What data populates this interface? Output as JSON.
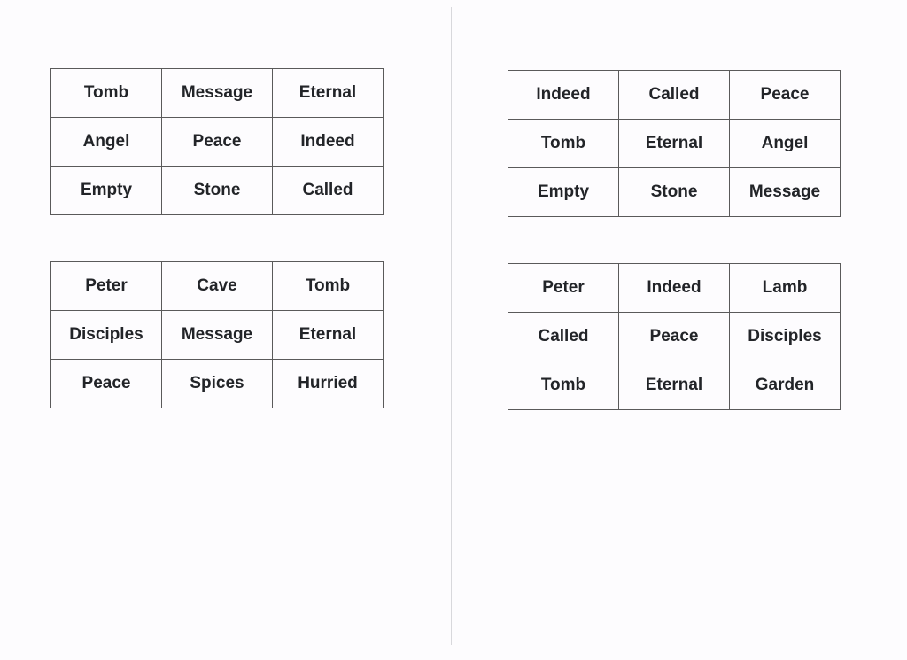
{
  "grids": [
    {
      "rows": [
        [
          "Tomb",
          "Message",
          "Eternal"
        ],
        [
          "Angel",
          "Peace",
          "Indeed"
        ],
        [
          "Empty",
          "Stone",
          "Called"
        ]
      ]
    },
    {
      "rows": [
        [
          "Peter",
          "Cave",
          "Tomb"
        ],
        [
          "Disciples",
          "Message",
          "Eternal"
        ],
        [
          "Peace",
          "Spices",
          "Hurried"
        ]
      ]
    },
    {
      "rows": [
        [
          "Indeed",
          "Called",
          "Peace"
        ],
        [
          "Tomb",
          "Eternal",
          "Angel"
        ],
        [
          "Empty",
          "Stone",
          "Message"
        ]
      ]
    },
    {
      "rows": [
        [
          "Peter",
          "Indeed",
          "Lamb"
        ],
        [
          "Called",
          "Peace",
          "Disciples"
        ],
        [
          "Tomb",
          "Eternal",
          "Garden"
        ]
      ]
    }
  ]
}
